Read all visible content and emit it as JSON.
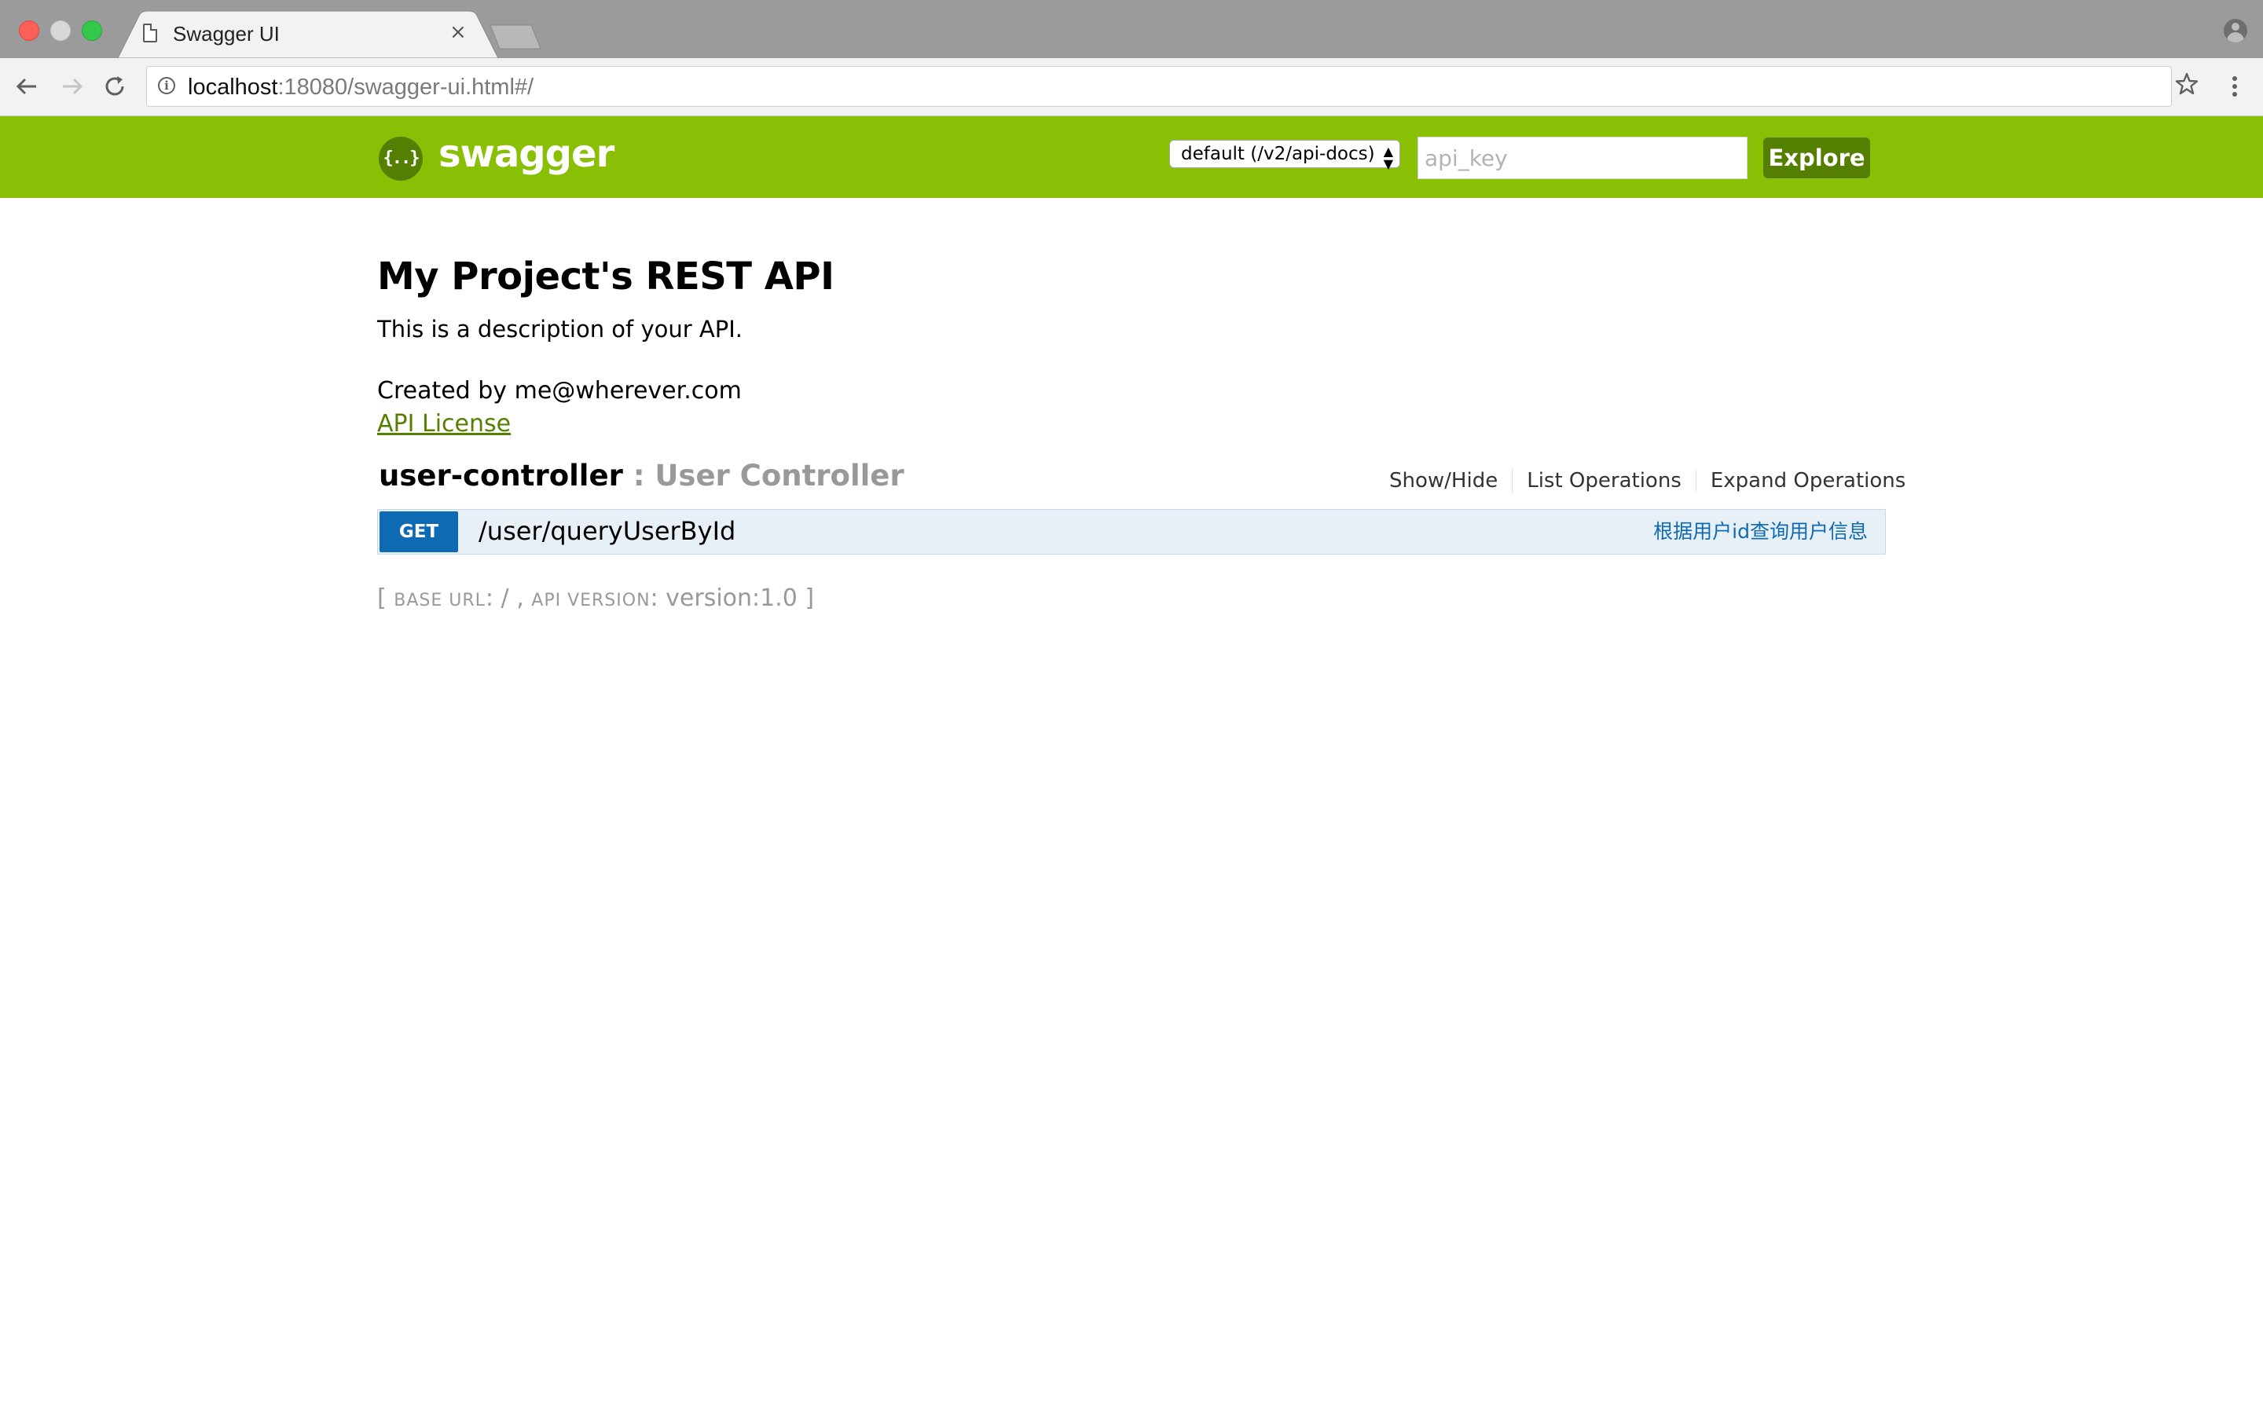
{
  "browser": {
    "tab_title": "Swagger UI",
    "tab_close": "×",
    "url_host": "localhost",
    "url_rest": ":18080/swagger-ui.html#/",
    "icons": [
      "back-icon",
      "forward-icon",
      "reload-icon",
      "info-icon",
      "star-icon",
      "menu-icon",
      "profile-icon",
      "document-icon"
    ]
  },
  "header": {
    "logo_mark": "{..}",
    "logo_text": "swagger",
    "spec_select": "default (/v2/api-docs)",
    "api_key_placeholder": "api_key",
    "explore_label": "Explore",
    "bg_color": "#89bf04",
    "accent_color": "#547f00"
  },
  "info": {
    "title": "My Project's REST API",
    "description": "This is a description of your API.",
    "created_by": "Created by me@wherever.com",
    "license_label": "API License"
  },
  "resource": {
    "name": "user-controller",
    "description": " : User Controller",
    "actions": {
      "show_hide": "Show/Hide",
      "list_operations": "List Operations",
      "expand_operations": "Expand Operations"
    },
    "operations": [
      {
        "method": "GET",
        "path": "/user/queryUserById",
        "summary": "根据用户id查询用户信息",
        "method_color": "#0f6ab4"
      }
    ]
  },
  "footer": {
    "open_bracket": "[ ",
    "base_url_label": "BASE URL",
    "base_url_value": ": / , ",
    "api_version_label": "API VERSION",
    "api_version_value": ": version:1.0 ]"
  }
}
